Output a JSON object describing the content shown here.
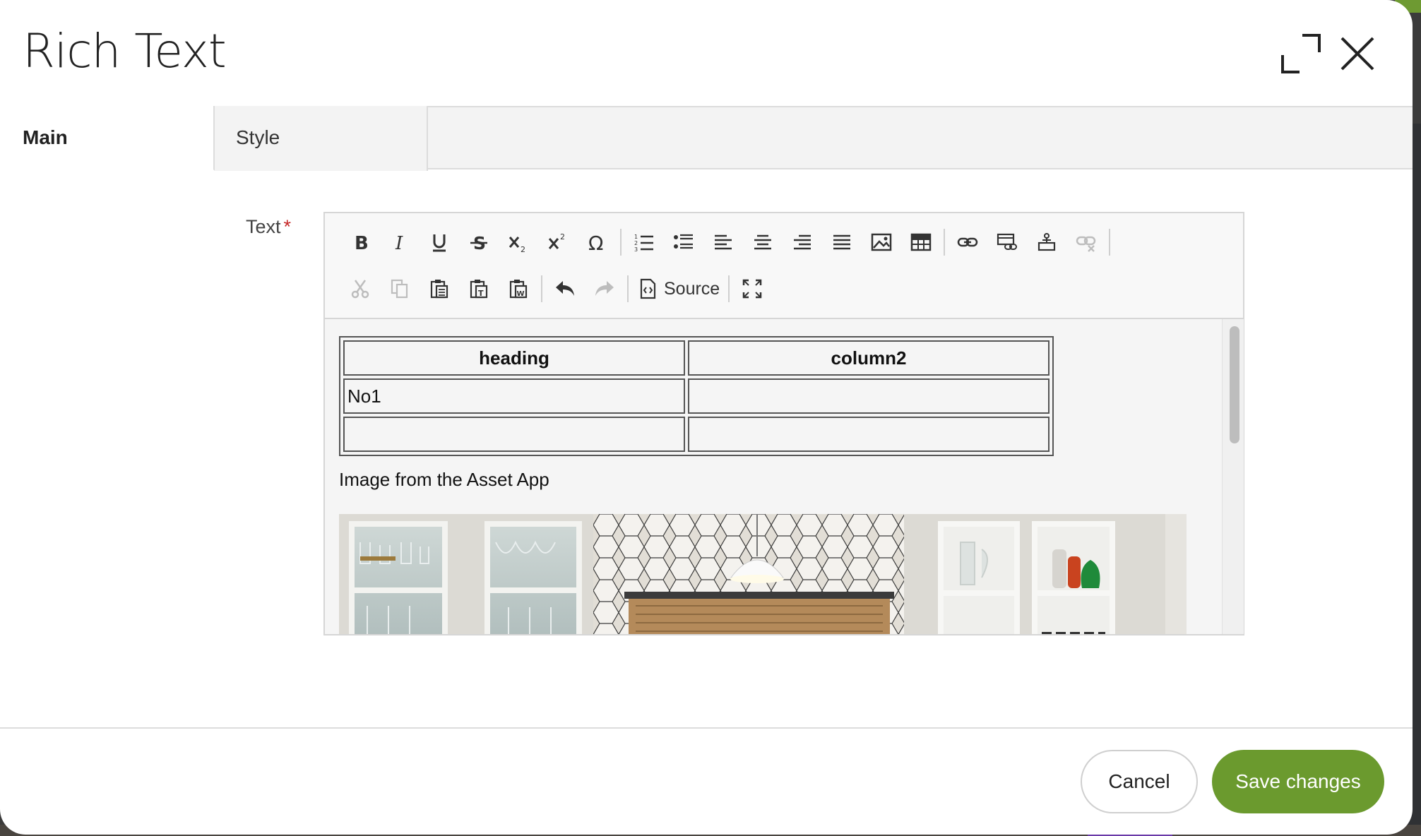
{
  "dialog": {
    "title": "Rich Text",
    "expand_icon": "expand-icon",
    "close_icon": "close-icon"
  },
  "tabs": [
    {
      "label": "Main",
      "active": true
    },
    {
      "label": "Style",
      "active": false
    }
  ],
  "field": {
    "label": "Text",
    "required_mark": "*"
  },
  "toolbar": {
    "row1": [
      "bold-icon",
      "italic-icon",
      "underline-icon",
      "strikethrough-icon",
      "subscript-icon",
      "superscript-icon",
      "special-character-icon",
      "numbered-list-icon",
      "bulleted-list-icon",
      "align-left-icon",
      "align-center-icon",
      "align-right-icon",
      "justify-icon",
      "image-icon",
      "table-icon",
      "link-icon",
      "anchor-link-icon",
      "insert-anchor-icon",
      "unlink-icon"
    ],
    "row2": [
      "cut-icon",
      "copy-icon",
      "paste-icon",
      "paste-text-icon",
      "paste-word-icon",
      "undo-icon",
      "redo-icon",
      "source-icon",
      "maximize-icon"
    ],
    "source_label": "Source"
  },
  "content": {
    "table": {
      "headers": [
        "heading",
        "column2"
      ],
      "rows": [
        [
          "No1",
          ""
        ],
        [
          "",
          ""
        ]
      ]
    },
    "paragraph": "Image from the Asset App"
  },
  "footer": {
    "cancel_label": "Cancel",
    "save_label": "Save changes"
  },
  "colors": {
    "accent": "#6b9a2e",
    "required": "#c62828"
  }
}
